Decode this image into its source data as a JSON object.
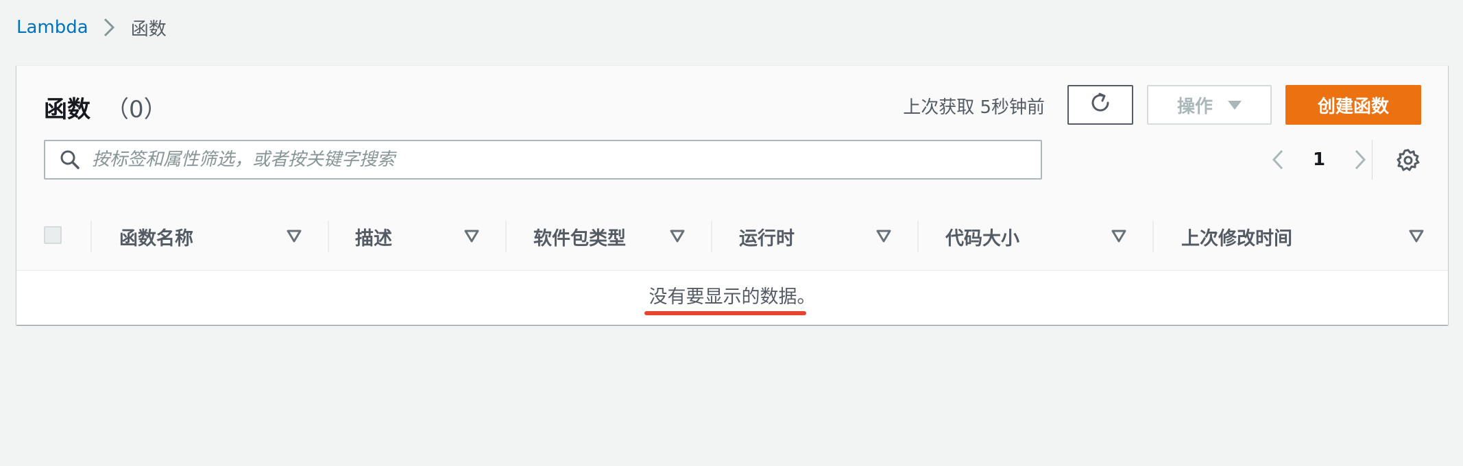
{
  "breadcrumb": {
    "root": "Lambda",
    "current": "函数"
  },
  "panel": {
    "title": "函数",
    "count": "（0）",
    "last_fetched": "上次获取 5秒钟前",
    "actions_label": "操作",
    "create_label": "创建函数",
    "search_placeholder": "按标签和属性筛选，或者按关键字搜索",
    "page_number": "1"
  },
  "table": {
    "columns": [
      "函数名称",
      "描述",
      "软件包类型",
      "运行时",
      "代码大小",
      "上次修改时间"
    ],
    "empty_message": "没有要显示的数据。"
  },
  "colors": {
    "accent": "#ec7211",
    "link": "#0073bb",
    "highlight": "#e8432f"
  }
}
